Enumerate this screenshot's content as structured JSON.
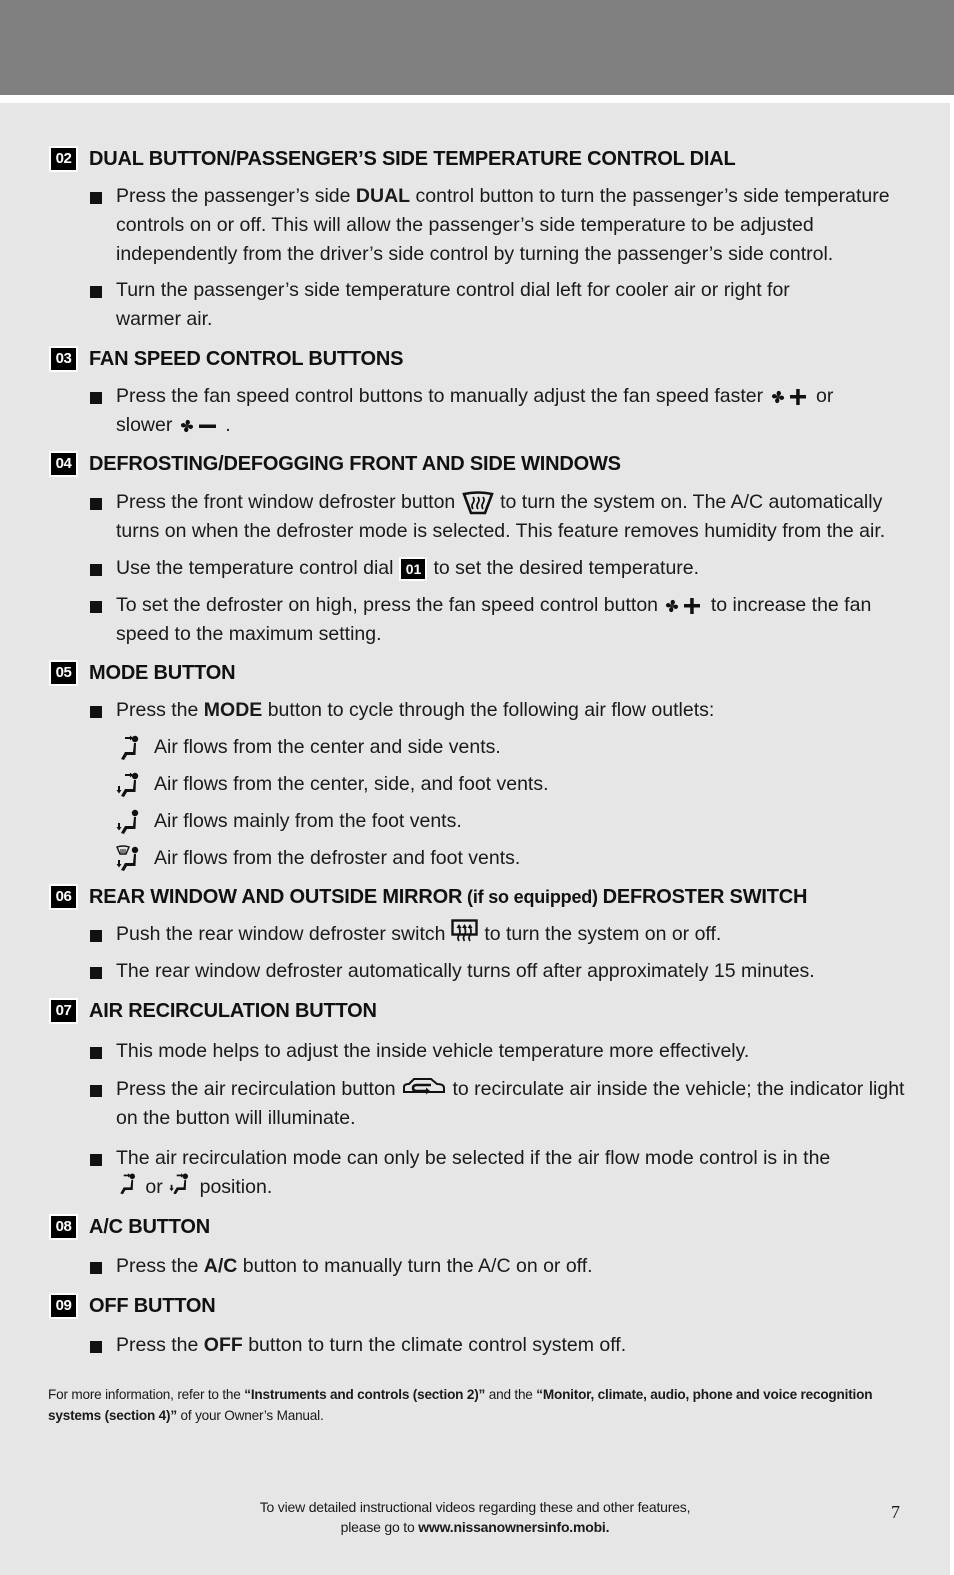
{
  "colors": {
    "header_band": "#808080",
    "page_bg": "#e6e6e6",
    "badge_bg": "#000000",
    "text": "#1a1a1a"
  },
  "sections": [
    {
      "number": "02",
      "title": "DUAL BUTTON/PASSENGER’S SIDE TEMPERATURE CONTROL DIAL",
      "bullets": [
        {
          "pre": "Press the passenger’s side ",
          "bold": "DUAL",
          "post": " control button to turn the passenger’s side temperature controls on or off. This will allow the passenger’s side temperature to be adjusted independently from the driver’s side control by turning the passenger’s side control."
        },
        {
          "text": "Turn the passenger’s side temperature control dial left for cooler air or right for warmer air."
        }
      ]
    },
    {
      "number": "03",
      "title": "FAN SPEED CONTROL BUTTONS",
      "bullets": [
        {
          "pre": "Press the fan speed control buttons to manually adjust the fan speed faster",
          "icon1": "fan-plus-icon",
          "mid": " or slower",
          "icon2": "fan-minus-icon",
          "post": " ."
        }
      ]
    },
    {
      "number": "04",
      "title": "DEFROSTING/DEFOGGING FRONT AND SIDE WINDOWS",
      "bullets": [
        {
          "pre": "Press the front window defroster button",
          "icon": "front-defroster-icon",
          "post": " to turn the system on. The A/C automatically turns on when the defroster mode is selected. This feature removes humidity from the air."
        },
        {
          "pre": "Use the temperature control dial",
          "badge": "01",
          "post": "to set the desired temperature."
        },
        {
          "pre": "To set the defroster on high, press the fan speed control button",
          "icon": "fan-plus-icon",
          "post": " to increase the fan speed to the maximum setting."
        }
      ]
    },
    {
      "number": "05",
      "title": "MODE BUTTON",
      "bullets": [
        {
          "pre": "Press the ",
          "bold": "MODE",
          "post": " button to cycle through the following air flow outlets:"
        }
      ],
      "modes": [
        {
          "icon": "vent-center-side-icon",
          "text": "Air flows from the center and side vents."
        },
        {
          "icon": "vent-center-side-foot-icon",
          "text": "Air flows from the center, side, and foot vents."
        },
        {
          "icon": "vent-foot-icon",
          "text": "Air flows mainly from the foot vents."
        },
        {
          "icon": "vent-defrost-foot-icon",
          "text": "Air flows from the defroster and foot vents."
        }
      ]
    },
    {
      "number": "06",
      "title": "REAR WINDOW AND OUTSIDE MIRROR",
      "title_mid": " (if so equipped) ",
      "title_end": "DEFROSTER SWITCH",
      "bullets": [
        {
          "pre": "Push the rear window defroster switch",
          "icon": "rear-defroster-icon",
          "post": "to turn the system on or off."
        },
        {
          "text": "The rear window defroster automatically turns off after approximately 15 minutes."
        }
      ]
    },
    {
      "number": "07",
      "title": "AIR RECIRCULATION BUTTON",
      "bullets": [
        {
          "text": "This mode helps to adjust the inside vehicle temperature more effectively."
        },
        {
          "pre": "Press the air recirculation button",
          "icon": "air-recirculation-icon",
          "post": "to recirculate air inside the vehicle; the indicator light on the button will illuminate."
        },
        {
          "pre": "The air recirculation mode can only be selected if the air flow mode control is in the",
          "mid": " or ",
          "post": " position."
        }
      ]
    },
    {
      "number": "08",
      "title": "A/C BUTTON",
      "bullets": [
        {
          "pre": "Press the ",
          "bold": "A/C",
          "post": " button to manually turn the A/C on or off."
        }
      ]
    },
    {
      "number": "09",
      "title": "OFF BUTTON",
      "bullets": [
        {
          "pre": "Press the ",
          "bold": "OFF",
          "post": " button to turn the climate control system off."
        }
      ]
    }
  ],
  "footnote": {
    "pre": "For more information, refer to the ",
    "ref1": "“Instruments and controls (section 2)”",
    "mid": " and the ",
    "ref2": "“Monitor, climate, audio, phone and voice recognition systems (section 4)”",
    "post": " of your Owner’s Manual."
  },
  "footer": {
    "line1": "To view detailed instructional videos regarding these and other features,",
    "line2_pre": "please go to ",
    "url": "www.nissanownersinfo.mobi."
  },
  "page_number": "7"
}
